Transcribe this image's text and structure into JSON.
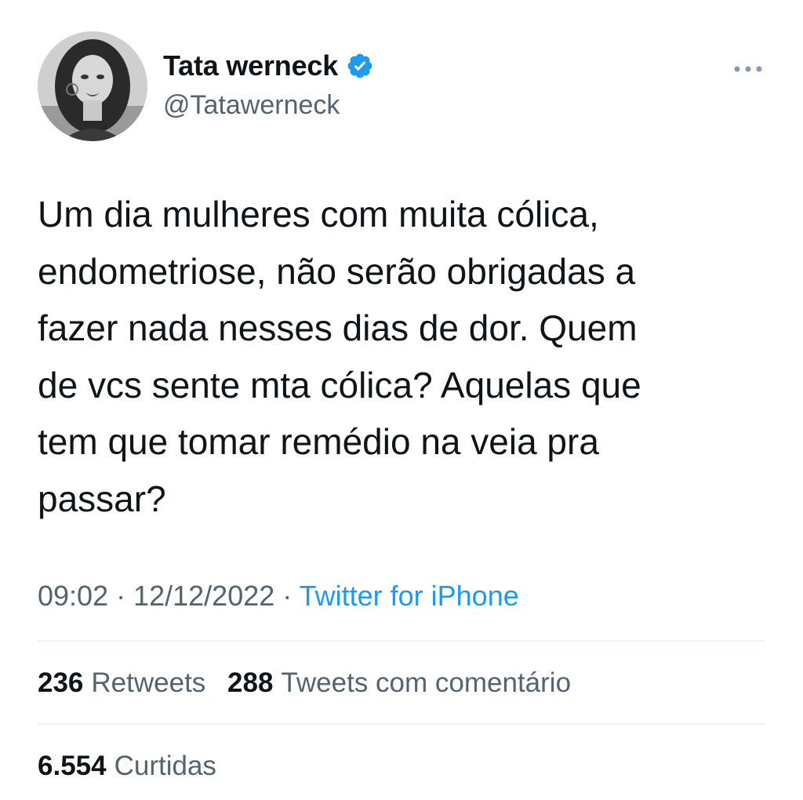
{
  "author": {
    "display_name": "Tata werneck",
    "handle": "@Tatawerneck",
    "verified_icon": "verified-badge-icon",
    "avatar_icon": "profile-photo"
  },
  "menu": {
    "more_icon": "more-horizontal-icon"
  },
  "tweet": {
    "text": "Um dia mulheres com muita cólica,\nendometriose, não serão obrigadas a\nfazer nada nesses dias de dor. Quem\nde vcs sente mta cólica? Aquelas que\ntem que tomar remédio na veia pra\npassar?",
    "time": "09:02",
    "separator": " · ",
    "date": "12/12/2022",
    "source": "Twitter for iPhone"
  },
  "stats": {
    "retweets_count": "236",
    "retweets_label": "Retweets",
    "quotes_count": "288",
    "quotes_label": "Tweets com comentário",
    "likes_count": "6.554",
    "likes_label": "Curtidas"
  },
  "colors": {
    "text_primary": "#0f1419",
    "text_secondary": "#536471",
    "accent": "#1d9bf0",
    "divider": "#eff3f4"
  }
}
